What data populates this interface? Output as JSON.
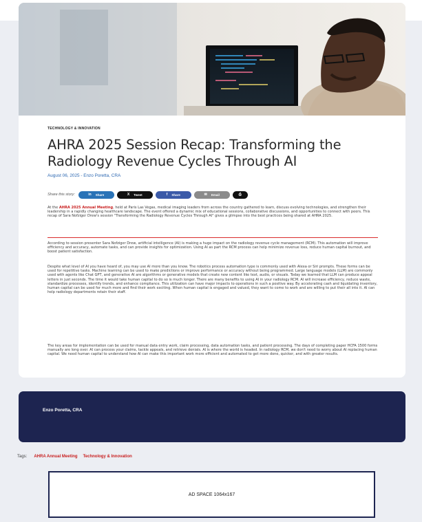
{
  "article": {
    "category": "TECHNOLOGY & INNOVATION",
    "title": "AHRA 2025 Session Recap: Transforming the Radiology Revenue Cycles Through AI",
    "meta": "August 06, 2025 - Enzo Poretta, CRA"
  },
  "share": {
    "label": "Share this story:",
    "buttons": [
      {
        "icon": "in",
        "label": "Share",
        "color": "#2a73b7",
        "icon_name": "linkedin-icon"
      },
      {
        "icon": "X",
        "label": "Tweet",
        "color": "#111111",
        "icon_name": "x-icon"
      },
      {
        "icon": "f",
        "label": "Share",
        "color": "#3b5aa8",
        "icon_name": "facebook-icon"
      },
      {
        "icon": "✉",
        "label": "Email",
        "color": "#8b8b8b",
        "icon_name": "email-icon"
      },
      {
        "icon": "⎙",
        "label": "",
        "color": "#111111",
        "icon_name": "print-icon"
      }
    ]
  },
  "body": {
    "p1_pre": "At the ",
    "p1_link": "AHRA 2025 Annual Meeting",
    "p1_post": ", held at Paris Las Vegas, medical imaging leaders from across the country gathered to learn, discuss evolving technologies, and strengthen their leadership in a rapidly changing healthcare landscape. The event offered a dynamic mix of educational sessions, collaborative discussions, and opportunities to connect with peers. This recap of Sara Nofziger Drew's session \"Transforming the Radiology Revenue Cycles Through AI\" gives a glimpse into the best practices being shared at AHRA 2025.",
    "p2": "According to session presenter Sara Nofziger Drew, artificial intelligence (AI) is making a huge impact on the radiology revenue cycle management (RCM). This automation will improve efficiency and accuracy, automate tasks, and can provide insights for optimization. Using AI as part the RCM process can help minimize revenue loss, reduce human capital burnout, and boost patient satisfaction.",
    "p3": "Despite what level of AI you have heard of, you may use AI more than you know. The robotics process automation type is commonly used with Alexa or Siri prompts. These forms can be used for repetitive tasks. Machine learning can be used to make predictions or improve performance or accuracy without being programmed. Large language models (LLM) are commonly used with agents like Chat GPT, and generative AI are algorithms or generative models that create new content like text, audio, or visuals. Today we learned that LLM can produce appeal letters in just seconds. The time it would take human capital to do so is much longer. There are many benefits to using AI in your radiology RCM. AI will increase efficiency, reduce waste, standardize processes, identify trends, and enhance compliance. This utilization can have major impacts to operations in such a positive way. By accelerating cash and liquidating inventory, human capital can be used for much more and find their work exciting. When human capital is engaged and valued, they want to come to work and are willing to put their all into it. AI can help radiology departments retain their staff.",
    "p4": "The key areas for implementation can be used for manual data entry work, claim processing, data automation tasks, and patient processing. The days of completing paper HCFA 1500 forms manually are long over. AI can process your claims, tackle appeals, and retrieve denials. AI is where the world is headed. In radiology RCM, we don't need to worry about AI replacing human capital. We need human capital to understand how AI can make this important work more efficient and automated to get more done, quicker, and with greater results."
  },
  "author": {
    "name": "Enzo Poretta, CRA"
  },
  "tags": {
    "label": "Tags:",
    "items": [
      "AHRA Annual Meeting",
      "Technology & Innovation"
    ]
  },
  "ad": {
    "text": "AD SPACE 1064x167"
  },
  "colors": {
    "accent_red": "#c81e1e",
    "navy": "#1d2450",
    "link_blue": "#2b67b1"
  }
}
